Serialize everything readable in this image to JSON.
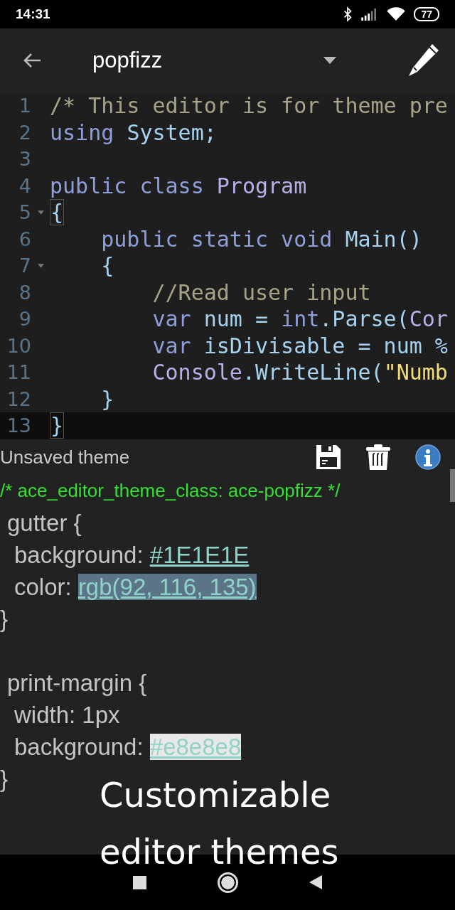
{
  "status_bar": {
    "time": "14:31",
    "battery": "77"
  },
  "toolbar": {
    "title": "popfizz"
  },
  "code_editor": {
    "lines": [
      {
        "number": "1",
        "fold": false,
        "active": false,
        "tokens": [
          {
            "t": "/* This editor is for theme pre",
            "kind": "comment"
          }
        ]
      },
      {
        "number": "2",
        "fold": false,
        "active": false,
        "tokens": [
          {
            "t": "using ",
            "kind": "keyword"
          },
          {
            "t": "System;",
            "kind": "ident"
          }
        ]
      },
      {
        "number": "3",
        "fold": false,
        "active": false
      },
      {
        "number": "4",
        "fold": false,
        "active": false,
        "tokens": [
          {
            "t": "public class ",
            "kind": "keyword"
          },
          {
            "t": "Program",
            "kind": "type"
          }
        ]
      },
      {
        "number": "5",
        "fold": true,
        "active": false,
        "tokens": [
          {
            "t": "{",
            "kind": "bracket-match"
          }
        ]
      },
      {
        "number": "6",
        "fold": false,
        "active": false,
        "tokens": [
          {
            "t": "    public static void ",
            "kind": "keyword"
          },
          {
            "t": "Main()",
            "kind": "ident"
          }
        ]
      },
      {
        "number": "7",
        "fold": true,
        "active": false,
        "tokens": [
          {
            "t": "    {",
            "kind": "ident"
          }
        ]
      },
      {
        "number": "8",
        "fold": false,
        "active": false,
        "tokens": [
          {
            "t": "        //Read user input",
            "kind": "comment"
          }
        ]
      },
      {
        "number": "9",
        "fold": false,
        "active": false,
        "tokens": [
          {
            "t": "        var ",
            "kind": "keyword"
          },
          {
            "t": "num = ",
            "kind": "ident"
          },
          {
            "t": "int",
            "kind": "keyword"
          },
          {
            "t": ".Parse(",
            "kind": "ident"
          },
          {
            "t": "Cor",
            "kind": "type"
          }
        ]
      },
      {
        "number": "10",
        "fold": false,
        "active": false,
        "tokens": [
          {
            "t": "        var ",
            "kind": "keyword"
          },
          {
            "t": "isDivisable = num %",
            "kind": "ident"
          }
        ]
      },
      {
        "number": "11",
        "fold": false,
        "active": false,
        "tokens": [
          {
            "t": "        Console",
            "kind": "type"
          },
          {
            "t": ".WriteLine(",
            "kind": "ident"
          },
          {
            "t": "\"Numb",
            "kind": "string"
          }
        ]
      },
      {
        "number": "12",
        "fold": false,
        "active": false,
        "tokens": [
          {
            "t": "    }",
            "kind": "ident"
          }
        ]
      },
      {
        "number": "13",
        "fold": false,
        "active": true,
        "tokens": [
          {
            "t": "}",
            "kind": "bracket-match"
          }
        ]
      }
    ]
  },
  "theme_panel": {
    "title": "Unsaved theme",
    "header_comment": "/* ace_editor_theme_class: ace-popfizz */",
    "blocks": [
      {
        "selector": "gutter {",
        "properties": [
          {
            "name": "background:",
            "value": "#1E1E1E"
          },
          {
            "name": "color:",
            "value": "rgb(92, 116, 135)",
            "color": "#5c7487"
          }
        ],
        "close": "}"
      },
      {
        "selector": "print-margin {",
        "properties": [
          {
            "name": "width: 1px"
          },
          {
            "name": "background:",
            "value": "#e8e8e8",
            "color": "#e8e8e8"
          }
        ],
        "close": "}"
      }
    ]
  },
  "caption": "Customizable editor themes"
}
